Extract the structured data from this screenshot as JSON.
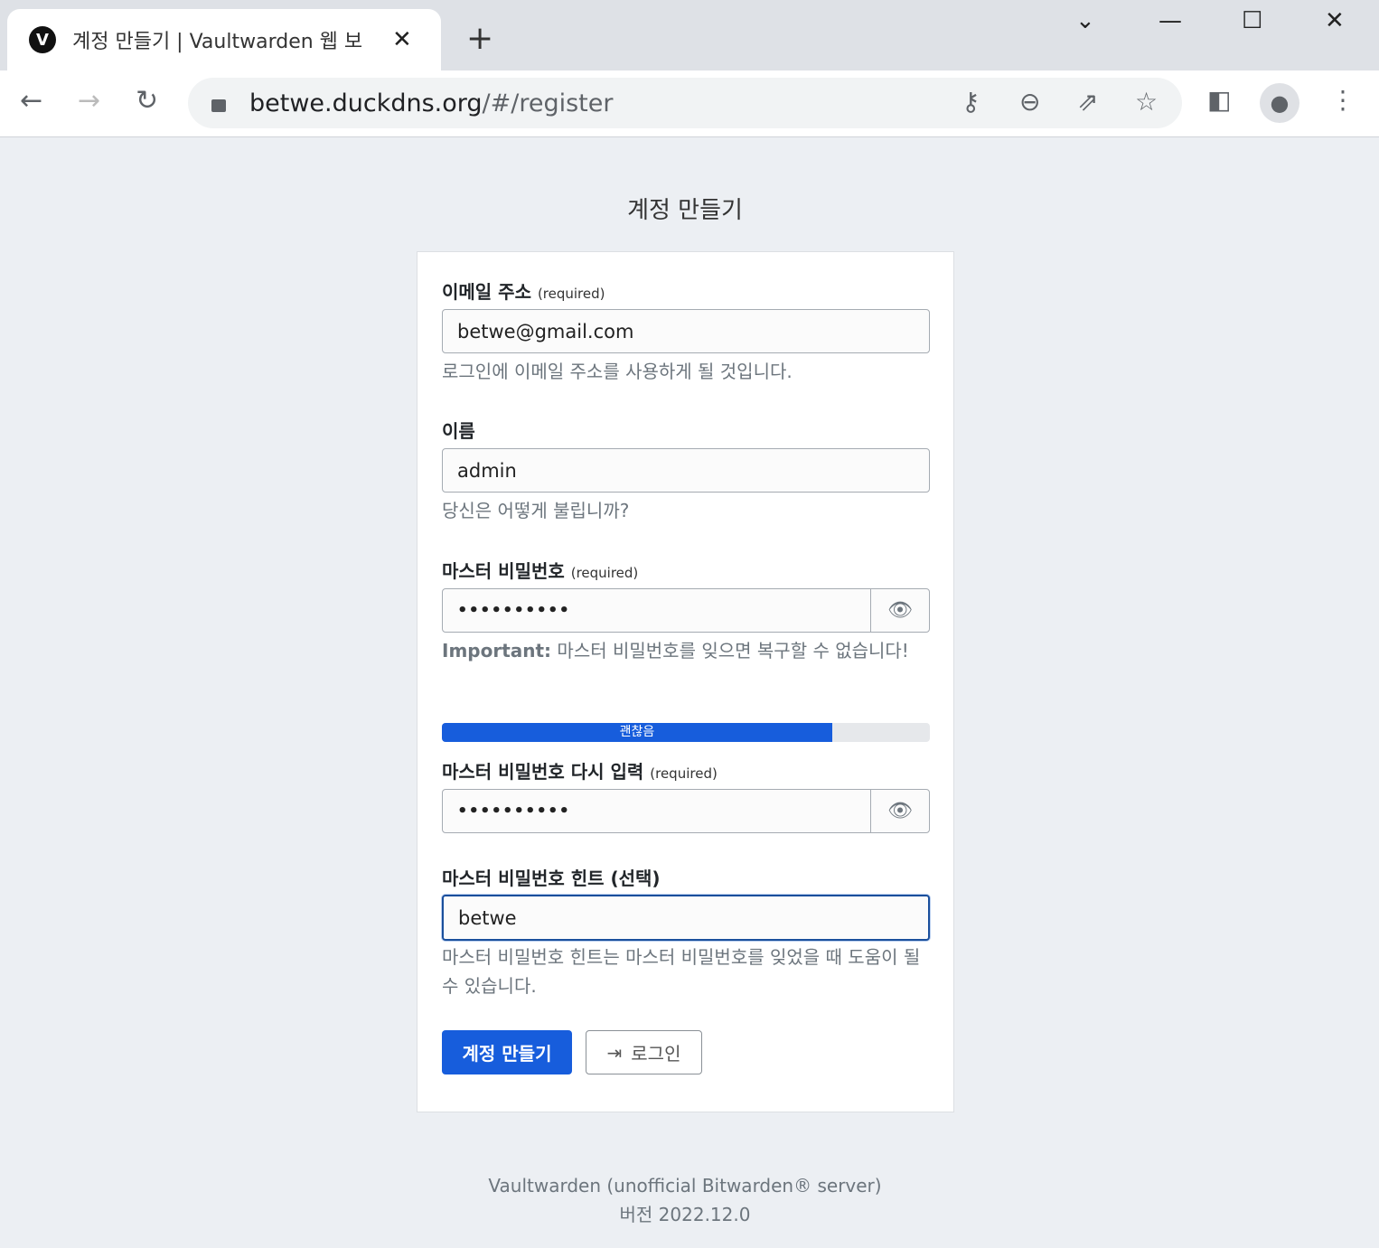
{
  "browser": {
    "tab_title": "계정 만들기 | Vaultwarden 웹 보",
    "url_host": "betwe.duckdns.org",
    "url_path": "/#/register",
    "favicon": "V"
  },
  "page": {
    "title": "계정 만들기"
  },
  "form": {
    "email": {
      "label": "이메일 주소",
      "required": "(required)",
      "value": "betwe@gmail.com",
      "help": "로그인에 이메일 주소를 사용하게 될 것입니다."
    },
    "name": {
      "label": "이름",
      "value": "admin",
      "help": "당신은 어떻게 불립니까?"
    },
    "password": {
      "label": "마스터 비밀번호",
      "required": "(required)",
      "value": "••••••••••",
      "help_bold": "Important:",
      "help": " 마스터 비밀번호를 잊으면 복구할 수 없습니다!"
    },
    "strength": {
      "label": "괜찮음",
      "percent": 80,
      "color": "#175ddc"
    },
    "password_confirm": {
      "label": "마스터 비밀번호 다시 입력",
      "required": "(required)",
      "value": "••••••••••"
    },
    "hint": {
      "label": "마스터 비밀번호 힌트 (선택)",
      "value": "betwe",
      "help": "마스터 비밀번호 힌트는 마스터 비밀번호를 잊었을 때 도움이 될 수 있습니다."
    },
    "submit_label": "계정 만들기",
    "login_label": "로그인"
  },
  "footer": {
    "line1": "Vaultwarden (unofficial Bitwarden® server)",
    "line2": "버전 2022.12.0"
  }
}
